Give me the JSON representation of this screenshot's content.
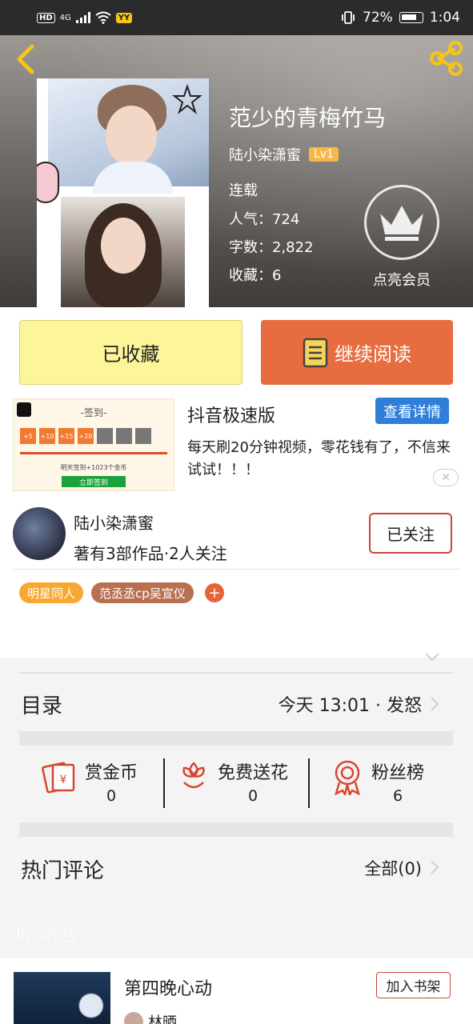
{
  "status_bar": {
    "hd": "HD",
    "network": "4G",
    "app_badge": "YY",
    "battery": "72%",
    "time": "1:04"
  },
  "book": {
    "title": "范少的青梅竹马",
    "author": "陆小染潇蜜",
    "author_level": "Lv1",
    "status": "连载",
    "popularity_label": "人气：",
    "popularity": "724",
    "words_label": "字数：",
    "words": "2,822",
    "favorites_label": "收藏：",
    "favorites": "6",
    "vip_label": "点亮会员"
  },
  "actions": {
    "favorited": "已收藏",
    "continue": "继续阅读"
  },
  "ad": {
    "title": "抖音极速版",
    "button": "查看详情",
    "description": "每天刷20分钟视频，零花钱有了，不信来试试！！！",
    "image_header": "-签到-",
    "image_rewards": [
      "+5",
      "+10",
      "+15",
      "+20"
    ],
    "image_line": "明天签到+1023个金币",
    "image_button": "立即签到",
    "close": "✕"
  },
  "author_card": {
    "name": "陆小染潇蜜",
    "works": "著有3部作品·2人关注",
    "follow": "已关注",
    "tags": [
      "明星同人",
      "范丞丞cp吴宣仪"
    ],
    "add_tag": "+"
  },
  "toc": {
    "label": "目录",
    "latest": "今天 13:01 · 发怒"
  },
  "stats": [
    {
      "label": "赏金币",
      "value": "0",
      "icon": "red-envelope-icon"
    },
    {
      "label": "免费送花",
      "value": "0",
      "icon": "flower-icon"
    },
    {
      "label": "粉丝榜",
      "value": "6",
      "icon": "medal-icon"
    }
  ],
  "comments": {
    "label": "热门评论",
    "all": "全部(0)"
  },
  "similar": {
    "label": "相似作品",
    "title": "第四晚心动",
    "add_button": "加入书架",
    "author": "林晒"
  },
  "colors": {
    "accent_orange": "#e76c3f",
    "fav_yellow": "#fdf59a",
    "primary_blue": "#2e7fd9",
    "follow_red": "#c9473a"
  }
}
